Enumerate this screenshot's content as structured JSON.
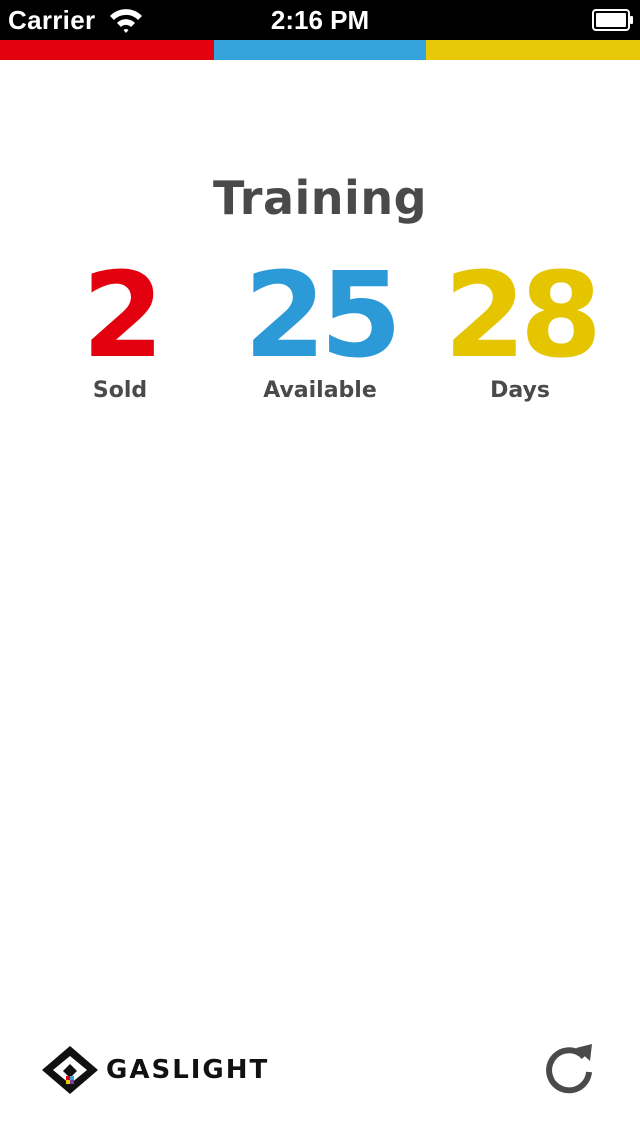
{
  "status_bar": {
    "carrier": "Carrier",
    "time": "2:16 PM",
    "wifi_icon": "wifi-icon",
    "battery_icon": "battery-icon"
  },
  "color_strip": {
    "colors": [
      "#e3000f",
      "#35a3dc",
      "#e8c90a"
    ]
  },
  "main": {
    "title": "Training",
    "stats": [
      {
        "value": "2",
        "label": "Sold",
        "color": "#e3000f"
      },
      {
        "value": "25",
        "label": "Available",
        "color": "#2b9ad6"
      },
      {
        "value": "28",
        "label": "Days",
        "color": "#e5c400"
      }
    ]
  },
  "footer": {
    "logo_text": "GASLIGHT",
    "refresh_icon": "refresh-icon"
  }
}
